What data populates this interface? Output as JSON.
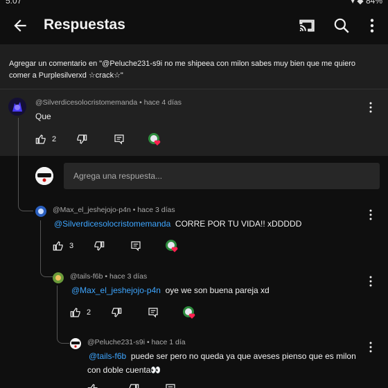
{
  "status": {
    "time": "5:07",
    "right": "▾ ◆ 84%"
  },
  "appbar": {
    "title": "Respuestas"
  },
  "context": {
    "text": "Agregar un comentario en \"@Peluche231-s9i no me shipeea con milon sabes muy bien que me quiero comer a Purplesilverxd ☆crack☆\""
  },
  "reply_input": {
    "placeholder": "Agrega una respuesta..."
  },
  "comments": [
    {
      "author": "@Silverdicesolocristomemanda",
      "time": "hace 4 días",
      "mention": "",
      "text": "Que",
      "likes": "2"
    },
    {
      "author": "@Max_el_jeshejojo-p4n",
      "time": "hace 3 días",
      "mention": "@Silverdicesolocristomemanda",
      "text": "CORRE POR TU VIDA!! xDDDDD",
      "likes": "3"
    },
    {
      "author": "@tails-f6b",
      "time": "hace 3 días",
      "mention": "@Max_el_jeshejojo-p4n",
      "text": "oye we son buena pareja xd",
      "likes": "2"
    },
    {
      "author": "@Peluche231-s9i",
      "time": "hace 1 día",
      "mention": "@tails-f6b",
      "text": "puede ser pero no queda ya que aveses pienso que es milon",
      "text2": "con doble cuenta👀",
      "likes": ""
    }
  ],
  "colors": {
    "mention": "#3ea6ff",
    "background": "#0f0f0f",
    "panel": "#212121"
  }
}
